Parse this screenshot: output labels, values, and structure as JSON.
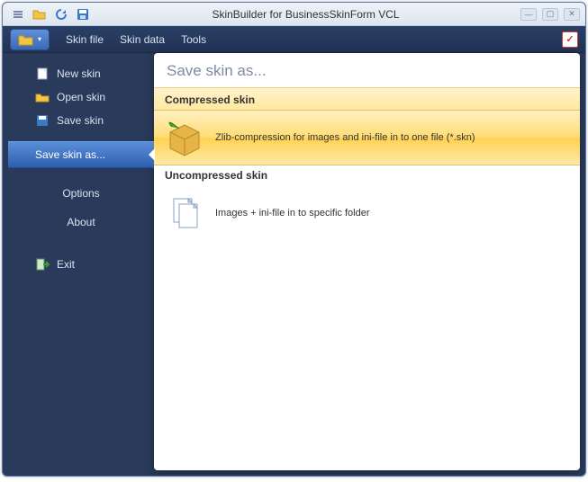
{
  "titlebar": {
    "title": "SkinBuilder for BusinessSkinForm VCL"
  },
  "menubar": {
    "items": [
      "Skin file",
      "Skin data",
      "Tools"
    ]
  },
  "sidebar": {
    "new_skin": "New skin",
    "open_skin": "Open skin",
    "save_skin": "Save skin",
    "save_skin_as": "Save skin as...",
    "options": "Options",
    "about": "About",
    "exit": "Exit"
  },
  "panel": {
    "title": "Save skin as...",
    "compressed_head": "Compressed skin",
    "compressed_desc": "Zlib-compression for images and ini-file in to one file (*.skn)",
    "uncompressed_head": "Uncompressed skin",
    "uncompressed_desc": "Images + ini-file in to specific folder"
  }
}
